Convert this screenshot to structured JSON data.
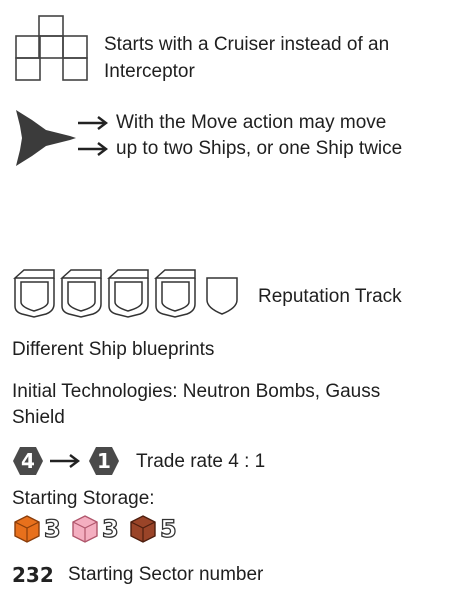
{
  "abilities": {
    "cruiser": {
      "line1": "Starts with a Cruiser instead of an",
      "line2": "Interceptor"
    },
    "move": {
      "line1": "With the Move action may move",
      "line2": "up to two Ships, or one Ship twice"
    }
  },
  "reputation": {
    "label": "Reputation Track",
    "slot_count": 5
  },
  "blueprints_text": "Different Ship blueprints",
  "technologies": {
    "line1": "Initial Technologies: Neutron Bombs, Gauss",
    "line2": "Shield"
  },
  "trade": {
    "from": "4",
    "to": "1",
    "label": "Trade rate 4 : 1"
  },
  "storage": {
    "label": "Starting Storage:",
    "items": [
      {
        "resource": "money",
        "color": "#e8701c",
        "amount": "3"
      },
      {
        "resource": "science",
        "color": "#f4aec0",
        "amount": "3"
      },
      {
        "resource": "materials",
        "color": "#9a4428",
        "amount": "5"
      }
    ]
  },
  "sector": {
    "number": "232",
    "label": "Starting Sector number"
  },
  "icons": {
    "cruiser": "cruiser-blueprint-icon",
    "ship": "ship-icon",
    "arrow": "arrow-right-icon",
    "shield": "reputation-shield-icon"
  }
}
